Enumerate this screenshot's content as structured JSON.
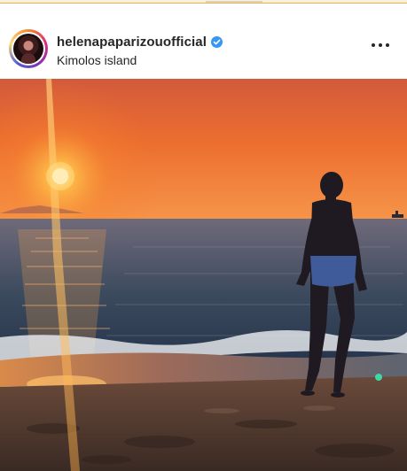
{
  "post": {
    "username": "helenapaparizouofficial",
    "location": "Kimolos island",
    "verified": true,
    "icons": {
      "verified": "verified-badge-icon",
      "more": "more-options-icon"
    }
  },
  "colors": {
    "verified_blue": "#3897f0",
    "text": "#262626",
    "sunset_orange": "#f0782a"
  }
}
